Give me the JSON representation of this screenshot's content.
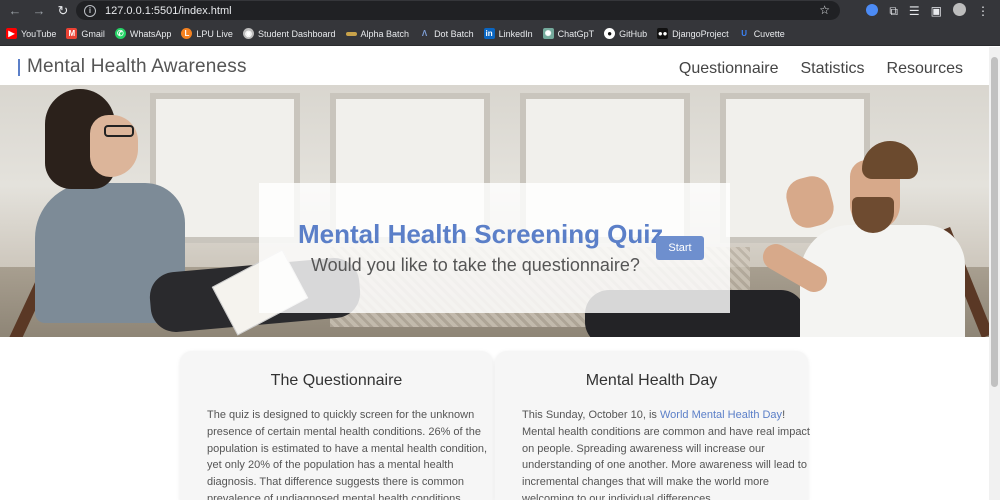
{
  "browser": {
    "url": "127.0.0.1:5501/index.html",
    "bookmarks": [
      {
        "label": "YouTube",
        "icon": "youtube-icon",
        "color": "#ff0000"
      },
      {
        "label": "Gmail",
        "icon": "gmail-icon",
        "color": "#ea4335"
      },
      {
        "label": "WhatsApp",
        "icon": "whatsapp-icon",
        "color": "#25d366"
      },
      {
        "label": "LPU Live",
        "icon": "lpu-live-icon",
        "color": "#f58220"
      },
      {
        "label": "Student Dashboard",
        "icon": "student-dashboard-icon",
        "color": "#bdbdbd"
      },
      {
        "label": "Alpha Batch",
        "icon": "alpha-batch-icon",
        "color": "#c8a24a"
      },
      {
        "label": "Dot Batch",
        "icon": "dot-batch-icon",
        "color": "#7fa0d8"
      },
      {
        "label": "LinkedIn",
        "icon": "linkedin-icon",
        "color": "#0a66c2"
      },
      {
        "label": "ChatGpT",
        "icon": "chatgpt-icon",
        "color": "#74aa9c"
      },
      {
        "label": "GitHub",
        "icon": "github-icon",
        "color": "#ffffff"
      },
      {
        "label": "DjangoProject",
        "icon": "django-icon",
        "color": "#0c4b33"
      },
      {
        "label": "Cuvette",
        "icon": "cuvette-icon",
        "color": "#3b82f6"
      }
    ]
  },
  "site": {
    "brand": "Mental Health Awareness",
    "nav": [
      "Questionnaire",
      "Statistics",
      "Resources"
    ]
  },
  "hero": {
    "title": "Mental Health Screening Quiz",
    "subtitle": "Would you like to take the questionnaire?",
    "button": "Start"
  },
  "cards": [
    {
      "title": "The Questionnaire",
      "body": "The quiz is designed to quickly screen for the unknown presence of certain mental health conditions. 26% of the population is estimated to have a mental health condition, yet only 20% of the population has a mental health diagnosis. That difference suggests there is common prevalence of undiagnosed mental health conditions."
    },
    {
      "title": "Mental Health Day",
      "body_before": "This Sunday, October 10, is ",
      "link": "World Mental Health Day",
      "body_after": "! Mental health conditions are common and have real impact on people. Spreading awareness will increase our understanding of one another. More awareness will lead to incremental changes that will make the world more welcoming to our individual differences."
    }
  ],
  "colors": {
    "accent": "#5b7fc8",
    "button": "#6e8fce",
    "chrome": "#35363a"
  }
}
